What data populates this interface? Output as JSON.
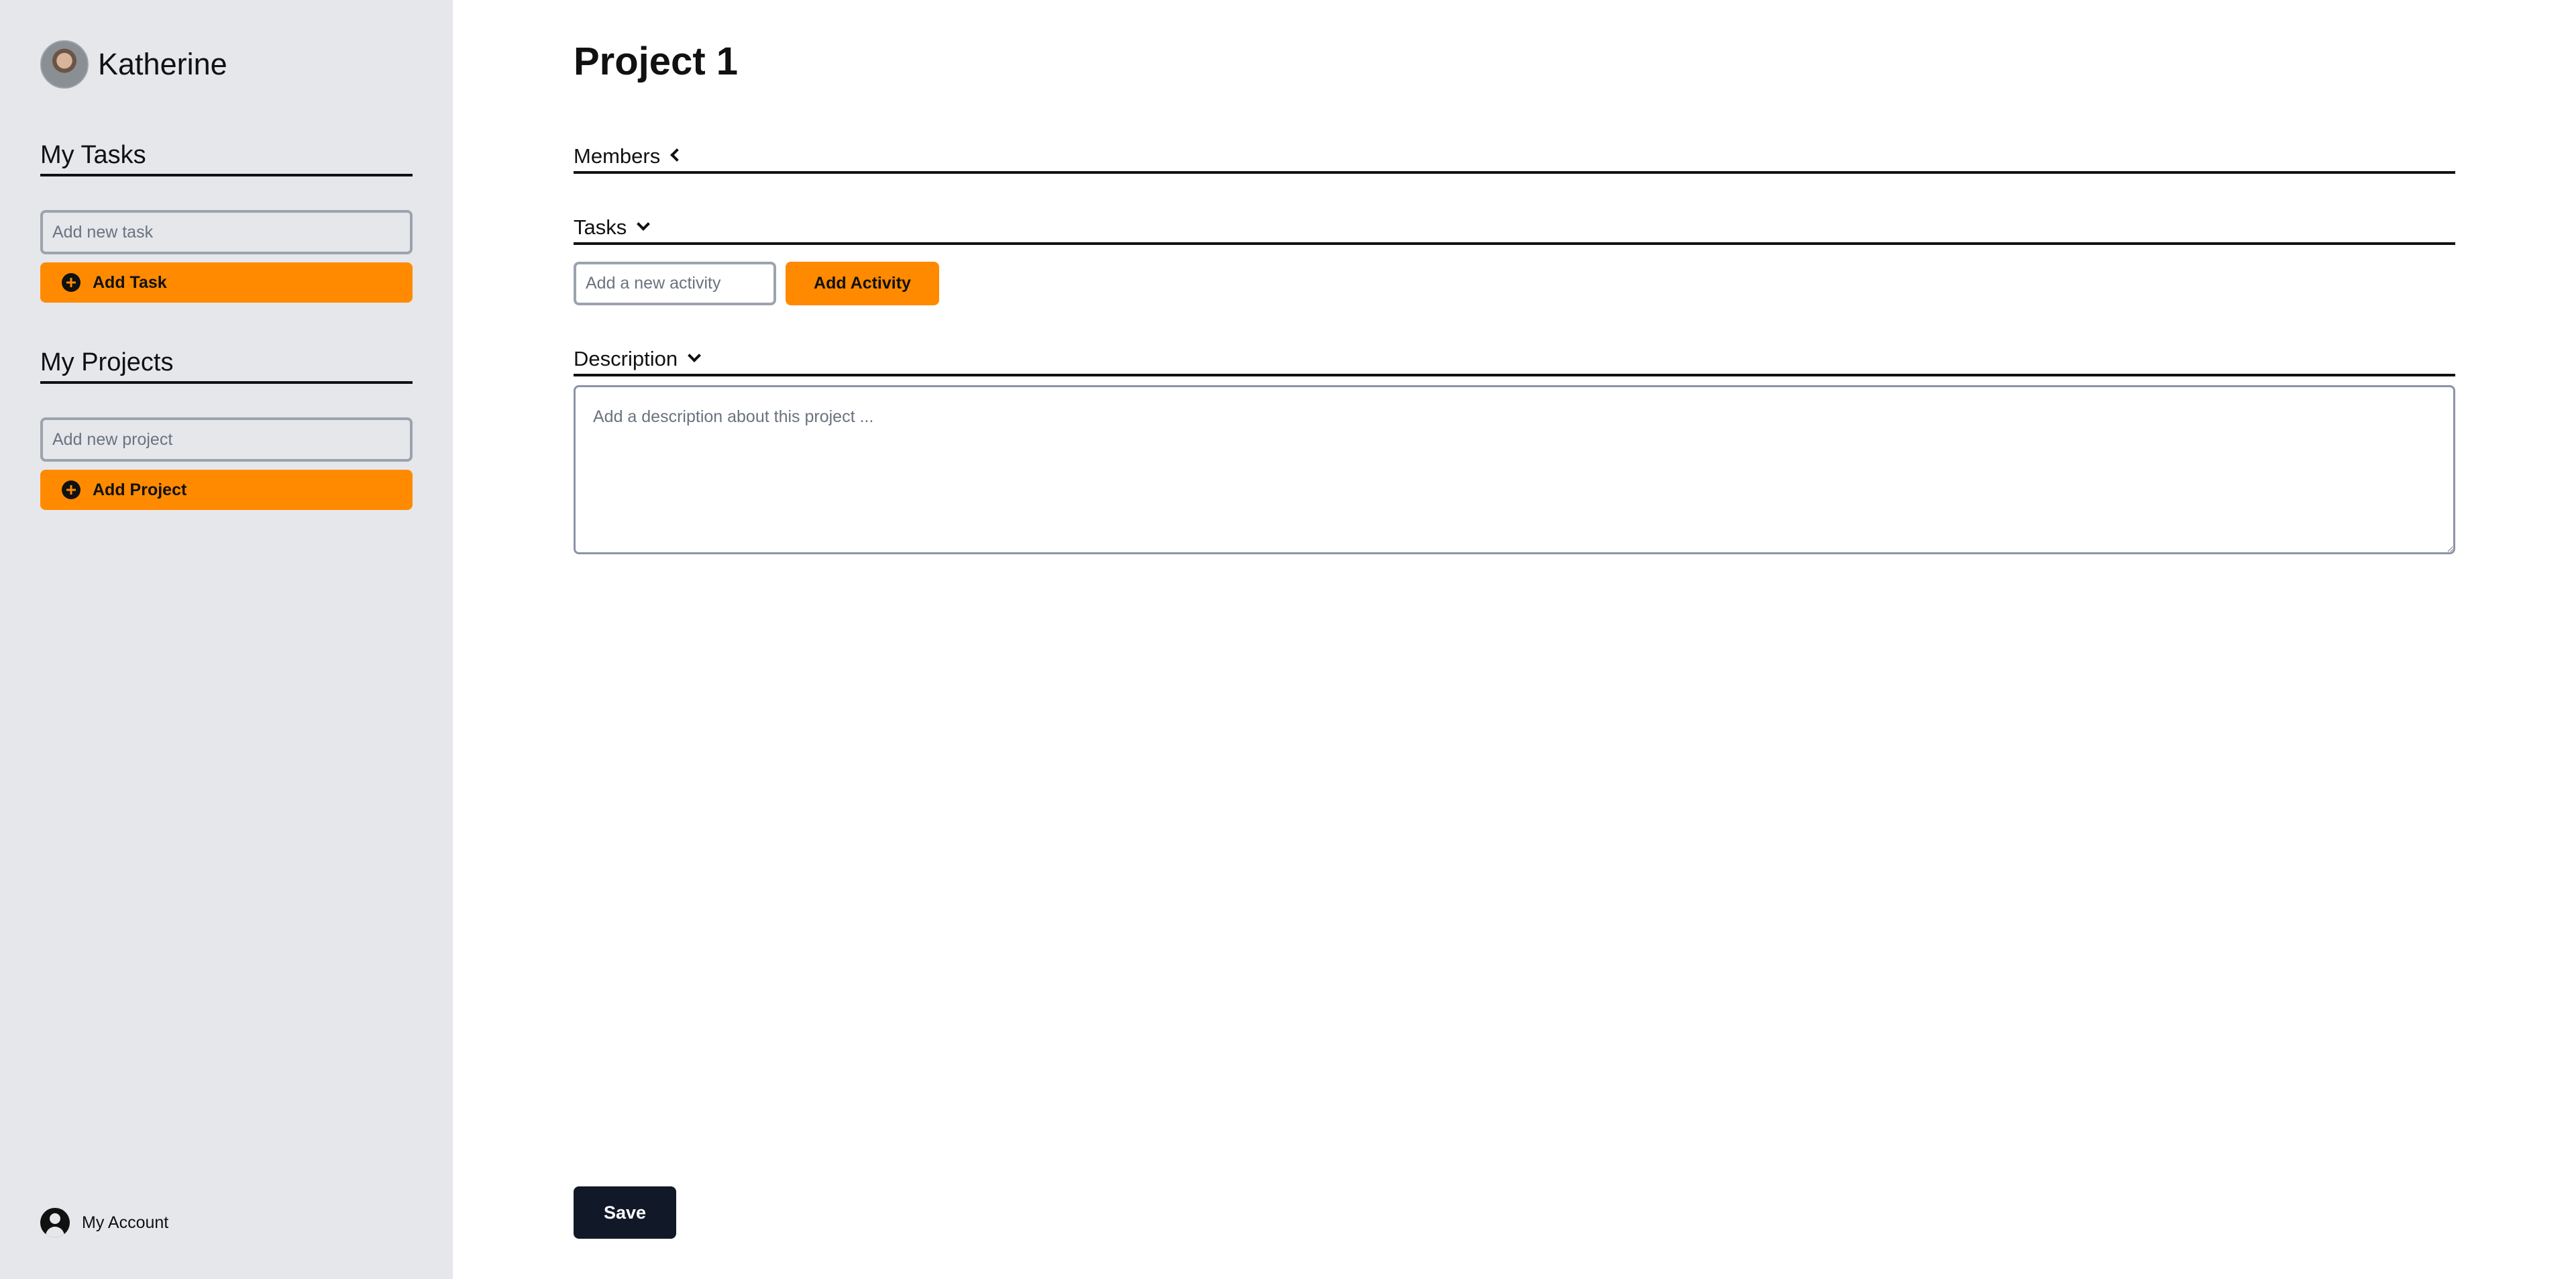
{
  "sidebar": {
    "user_name": "Katherine",
    "tasks_section": {
      "title": "My Tasks",
      "input_placeholder": "Add new task",
      "button_label": "Add Task"
    },
    "projects_section": {
      "title": "My Projects",
      "input_placeholder": "Add new project",
      "button_label": "Add Project"
    },
    "account_label": "My Account"
  },
  "main": {
    "title": "Project 1",
    "members": {
      "label": "Members",
      "state": "collapsed"
    },
    "tasks": {
      "label": "Tasks",
      "state": "expanded",
      "input_placeholder": "Add a new activity",
      "button_label": "Add Activity"
    },
    "description": {
      "label": "Description",
      "state": "expanded",
      "placeholder": "Add a description about this project ..."
    },
    "save_label": "Save"
  },
  "colors": {
    "accent": "#ff8a00",
    "sidebar_bg": "#e5e7eb",
    "primary_dark": "#111827"
  }
}
